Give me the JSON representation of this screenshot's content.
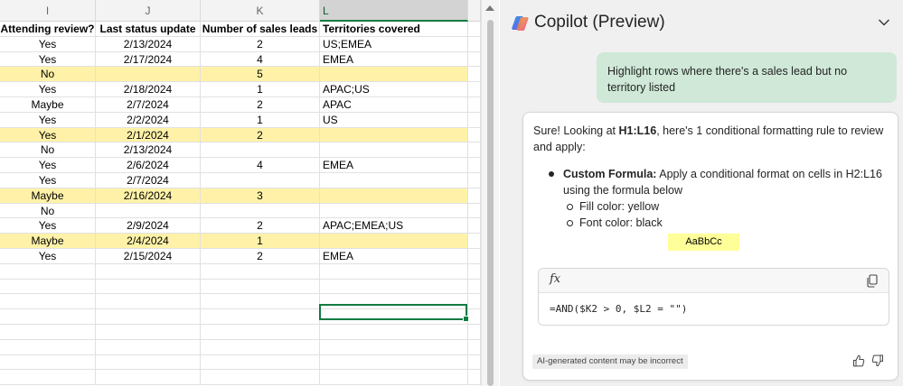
{
  "sheet": {
    "columns": [
      {
        "letter": "I",
        "selected": false
      },
      {
        "letter": "J",
        "selected": false
      },
      {
        "letter": "K",
        "selected": false
      },
      {
        "letter": "L",
        "selected": true
      }
    ],
    "header": {
      "attending": "Attending review?",
      "last_update": "Last status update",
      "leads": "Number of sales leads",
      "territories": "Territories covered"
    },
    "rows": [
      {
        "attending": "Yes",
        "last_update": "2/13/2024",
        "leads": "2",
        "territories": "US;EMEA",
        "highlight": false
      },
      {
        "attending": "Yes",
        "last_update": "2/17/2024",
        "leads": "4",
        "territories": "EMEA",
        "highlight": false
      },
      {
        "attending": "No",
        "last_update": "",
        "leads": "5",
        "territories": "",
        "highlight": true
      },
      {
        "attending": "Yes",
        "last_update": "2/18/2024",
        "leads": "1",
        "territories": "APAC;US",
        "highlight": false
      },
      {
        "attending": "Maybe",
        "last_update": "2/7/2024",
        "leads": "2",
        "territories": "APAC",
        "highlight": false
      },
      {
        "attending": "Yes",
        "last_update": "2/2/2024",
        "leads": "1",
        "territories": "US",
        "highlight": false
      },
      {
        "attending": "Yes",
        "last_update": "2/1/2024",
        "leads": "2",
        "territories": "",
        "highlight": true
      },
      {
        "attending": "No",
        "last_update": "2/13/2024",
        "leads": "",
        "territories": "",
        "highlight": false
      },
      {
        "attending": "Yes",
        "last_update": "2/6/2024",
        "leads": "4",
        "territories": "EMEA",
        "highlight": false
      },
      {
        "attending": "Yes",
        "last_update": "2/7/2024",
        "leads": "",
        "territories": "",
        "highlight": false
      },
      {
        "attending": "Maybe",
        "last_update": "2/16/2024",
        "leads": "3",
        "territories": "",
        "highlight": true
      },
      {
        "attending": "No",
        "last_update": "",
        "leads": "",
        "territories": "",
        "highlight": false
      },
      {
        "attending": "Yes",
        "last_update": "2/9/2024",
        "leads": "2",
        "territories": "APAC;EMEA;US",
        "highlight": false
      },
      {
        "attending": "Maybe",
        "last_update": "2/4/2024",
        "leads": "1",
        "territories": "",
        "highlight": true
      },
      {
        "attending": "Yes",
        "last_update": "2/15/2024",
        "leads": "2",
        "territories": "EMEA",
        "highlight": false
      }
    ],
    "empty_rows": 8,
    "highlight_color": "#fff2a8",
    "selection_color": "#107c41"
  },
  "copilot": {
    "title": "Copilot (Preview)",
    "user_message": "Highlight rows where there's a sales lead but no territory listed",
    "response": {
      "intro_before": "Sure! Looking at ",
      "intro_range": "H1:L16",
      "intro_after": ", here's 1 conditional formatting rule to review and apply:",
      "rule_title": "Custom Formula:",
      "rule_text": " Apply a conditional format on cells in H2:L16 using the formula below",
      "fill": "Fill color: yellow",
      "font": "Font color: black",
      "preview_label": "AaBbCc",
      "formula_icon": "fx",
      "formula": "=AND($K2 > 0, $L2 = \"\")",
      "disclaimer": "AI-generated content may be incorrect"
    },
    "icons": [
      "copilot-logo-icon",
      "chevron-down-icon",
      "copy-icon",
      "thumbs-up-icon",
      "thumbs-down-icon"
    ],
    "colors": {
      "user_bubble": "#cfe8d7",
      "pane_bg": "#f0f0f0",
      "preview_fill": "#ffff99"
    }
  }
}
